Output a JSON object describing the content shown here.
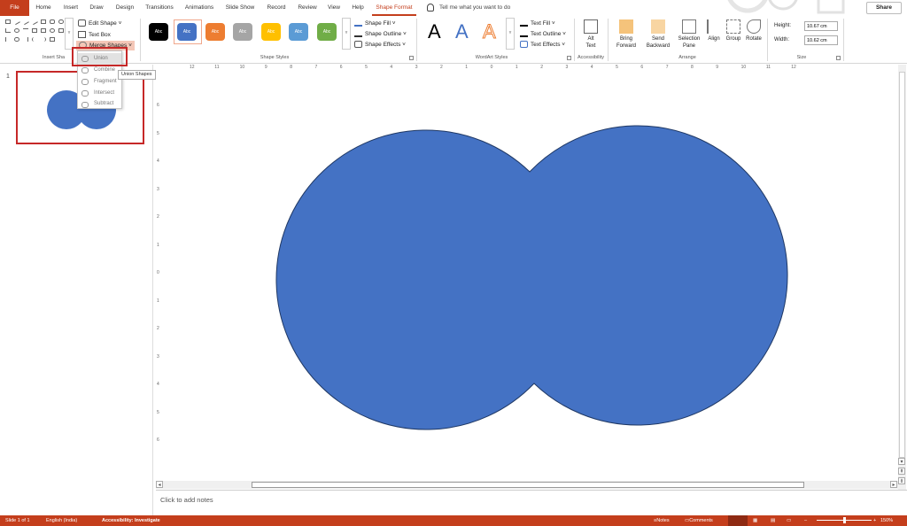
{
  "tabs": {
    "file": "File",
    "home": "Home",
    "insert": "Insert",
    "draw": "Draw",
    "design": "Design",
    "transitions": "Transitions",
    "animations": "Animations",
    "slideshow": "Slide Show",
    "record": "Record",
    "review": "Review",
    "view": "View",
    "help": "Help",
    "shape_format": "Shape Format"
  },
  "tell_me": "Tell me what you want to do",
  "share": "Share",
  "insert_shapes": {
    "edit_shape": "Edit Shape",
    "text_box": "Text Box",
    "merge_shapes": "Merge Shapes",
    "group_label": "Insert Sha"
  },
  "merge_menu": {
    "union": "Union",
    "combine": "Combine",
    "fragment": "Fragment",
    "intersect": "Intersect",
    "subtract": "Subtract",
    "tooltip": "Union Shapes"
  },
  "shape_styles": {
    "swatch_label": "Abc",
    "shape_fill": "Shape Fill",
    "shape_outline": "Shape Outline",
    "shape_effects": "Shape Effects",
    "group_label": "Shape Styles",
    "colors": [
      "#000000",
      "#4472c4",
      "#ed7d31",
      "#a5a5a5",
      "#ffc000",
      "#5b9bd5",
      "#70ad47"
    ]
  },
  "wordart": {
    "letter": "A",
    "text_fill": "Text Fill",
    "text_outline": "Text Outline",
    "text_effects": "Text Effects",
    "group_label": "WordArt Styles"
  },
  "accessibility": {
    "alt_text_1": "Alt",
    "alt_text_2": "Text",
    "group_label": "Accessibility"
  },
  "arrange": {
    "bring_forward_1": "Bring",
    "bring_forward_2": "Forward",
    "send_backward_1": "Send",
    "send_backward_2": "Backward",
    "selection_pane_1": "Selection",
    "selection_pane_2": "Pane",
    "align": "Align",
    "group": "Group",
    "rotate": "Rotate",
    "group_label": "Arrange"
  },
  "size": {
    "height_label": "Height:",
    "height_value": "10.67 cm",
    "width_label": "Width:",
    "width_value": "10.62 cm",
    "group_label": "Size"
  },
  "slide_number": "1",
  "ruler_h": [
    "12",
    "11",
    "10",
    "9",
    "8",
    "7",
    "6",
    "5",
    "4",
    "3",
    "2",
    "1",
    "0",
    "1",
    "2",
    "3",
    "4",
    "5",
    "6",
    "7",
    "8",
    "9",
    "10",
    "11",
    "12"
  ],
  "ruler_v": [
    "6",
    "5",
    "4",
    "3",
    "2",
    "1",
    "0",
    "1",
    "2",
    "3",
    "4",
    "5",
    "6"
  ],
  "notes_placeholder": "Click to add notes",
  "status": {
    "slide": "Slide 1 of 1",
    "language": "English (India)",
    "accessibility": "Accessibility: Investigate",
    "notes": "Notes",
    "comments": "Comments",
    "zoom": "150%"
  },
  "theme": {
    "accent": "#c43e1c",
    "shape_fill": "#4472c4",
    "highlight": "#c62828"
  }
}
